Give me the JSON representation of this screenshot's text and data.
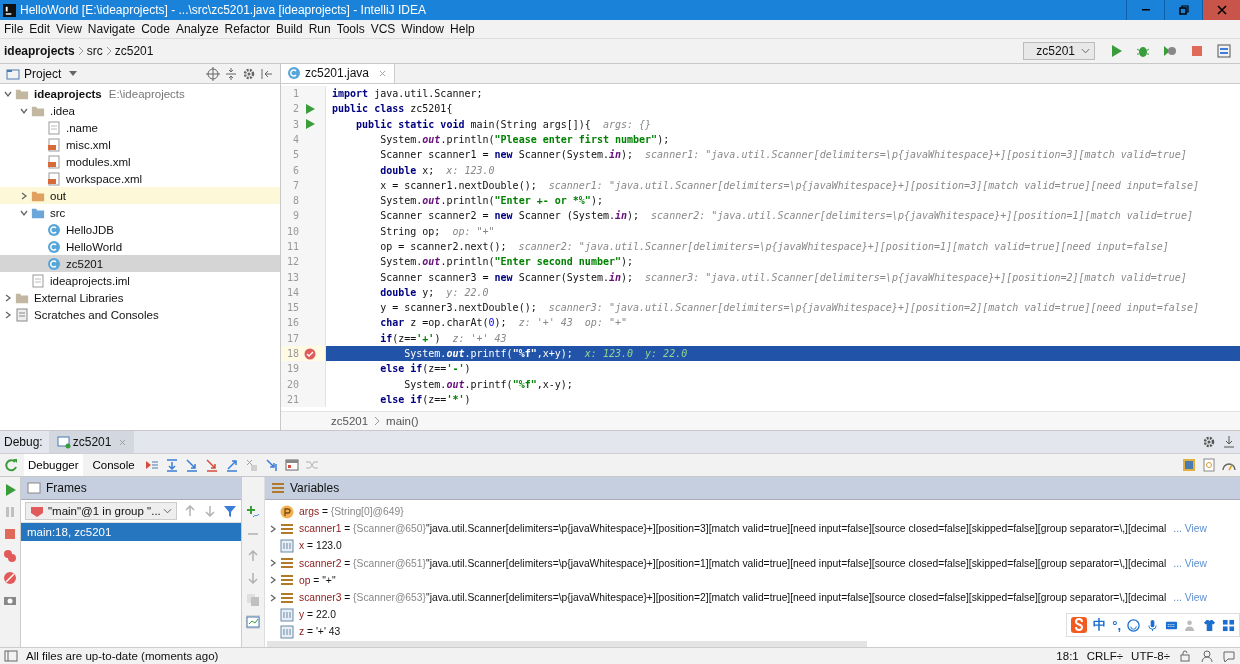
{
  "window": {
    "title": "HelloWorld [E:\\ideaprojects] - ...\\src\\zc5201.java [ideaprojects] - IntelliJ IDEA"
  },
  "menu": [
    "File",
    "Edit",
    "View",
    "Navigate",
    "Code",
    "Analyze",
    "Refactor",
    "Build",
    "Run",
    "Tools",
    "VCS",
    "Window",
    "Help"
  ],
  "breadcrumbs": [
    "ideaprojects",
    "src",
    "zc5201"
  ],
  "run_config": {
    "value": "zc5201"
  },
  "project_panel": {
    "title": "Project",
    "items": [
      {
        "label": "ideaprojects",
        "path": "E:\\ideaprojects",
        "kind": "module",
        "expanded": true,
        "selected": false,
        "excluded": false,
        "children": [
          {
            "label": ".idea",
            "kind": "folder",
            "expanded": true,
            "selected": false,
            "excluded": false,
            "children": [
              {
                "label": ".name",
                "kind": "file",
                "selected": false,
                "excluded": false
              },
              {
                "label": "misc.xml",
                "kind": "xml",
                "selected": false,
                "excluded": false
              },
              {
                "label": "modules.xml",
                "kind": "xml",
                "selected": false,
                "excluded": false
              },
              {
                "label": "workspace.xml",
                "kind": "xml",
                "selected": false,
                "excluded": false
              }
            ]
          },
          {
            "label": "out",
            "kind": "folder",
            "expanded": false,
            "selected": false,
            "excluded": true
          },
          {
            "label": "src",
            "kind": "source",
            "expanded": true,
            "selected": false,
            "excluded": false,
            "children": [
              {
                "label": "HelloJDB",
                "kind": "class",
                "selected": false,
                "excluded": false
              },
              {
                "label": "HelloWorld",
                "kind": "class",
                "selected": false,
                "excluded": false
              },
              {
                "label": "zc5201",
                "kind": "class",
                "selected": true,
                "excluded": false
              }
            ]
          },
          {
            "label": "ideaprojects.iml",
            "kind": "iml",
            "selected": false,
            "excluded": false
          }
        ]
      },
      {
        "label": "External Libraries",
        "kind": "library",
        "expanded": false,
        "selected": false,
        "excluded": false
      },
      {
        "label": "Scratches and Consoles",
        "kind": "scratch",
        "expanded": false,
        "selected": false,
        "excluded": false
      }
    ]
  },
  "editor": {
    "tab": "zc5201.java",
    "breadcrumb": [
      "zc5201",
      "main()"
    ],
    "lines": [
      {
        "number": "1",
        "tokens": [
          {
            "kind": "kw",
            "text": "import"
          },
          {
            "kind": "tx",
            "text": " java.util.Scanner;"
          }
        ]
      },
      {
        "number": "2",
        "run_marker": true,
        "tokens": [
          {
            "kind": "kw",
            "text": "public class"
          },
          {
            "kind": "tx",
            "text": " zc5201{"
          }
        ]
      },
      {
        "number": "3",
        "run_marker": true,
        "tokens": [
          {
            "kind": "kw",
            "text": "    public static void"
          },
          {
            "kind": "tx",
            "text": " main(String args[]){"
          }
        ],
        "hint": "args: {}"
      },
      {
        "number": "4",
        "tokens": [
          {
            "kind": "tx",
            "text": "        System."
          },
          {
            "kind": "fld",
            "text": "out"
          },
          {
            "kind": "tx",
            "text": ".println("
          },
          {
            "kind": "str",
            "text": "\"Please enter first number\""
          },
          {
            "kind": "tx",
            "text": ");"
          }
        ]
      },
      {
        "number": "5",
        "tokens": [
          {
            "kind": "tx",
            "text": "        Scanner scanner1 = "
          },
          {
            "kind": "kw",
            "text": "new"
          },
          {
            "kind": "tx",
            "text": " Scanner(System."
          },
          {
            "kind": "fld",
            "text": "in"
          },
          {
            "kind": "tx",
            "text": ");"
          }
        ],
        "hint": "scanner1: \"java.util.Scanner[delimiters=\\p{javaWhitespace}+][position=3][match valid=true]"
      },
      {
        "number": "6",
        "tokens": [
          {
            "kind": "kw",
            "text": "        double"
          },
          {
            "kind": "tx",
            "text": " x;"
          }
        ],
        "hint": "x: 123.0"
      },
      {
        "number": "7",
        "tokens": [
          {
            "kind": "tx",
            "text": "        x = scanner1.nextDouble();"
          }
        ],
        "hint": "scanner1: \"java.util.Scanner[delimiters=\\p{javaWhitespace}+][position=3][match valid=true][need input=false]"
      },
      {
        "number": "8",
        "tokens": [
          {
            "kind": "tx",
            "text": "        System."
          },
          {
            "kind": "fld",
            "text": "out"
          },
          {
            "kind": "tx",
            "text": ".println("
          },
          {
            "kind": "str",
            "text": "\"Enter +- or *%\""
          },
          {
            "kind": "tx",
            "text": ");"
          }
        ]
      },
      {
        "number": "9",
        "tokens": [
          {
            "kind": "tx",
            "text": "        Scanner scanner2 = "
          },
          {
            "kind": "kw",
            "text": "new"
          },
          {
            "kind": "tx",
            "text": " Scanner (System."
          },
          {
            "kind": "fld",
            "text": "in"
          },
          {
            "kind": "tx",
            "text": ");"
          }
        ],
        "hint": "scanner2: \"java.util.Scanner[delimiters=\\p{javaWhitespace}+][position=1][match valid=true]"
      },
      {
        "number": "10",
        "tokens": [
          {
            "kind": "tx",
            "text": "        String op;"
          }
        ],
        "hint": "op: \"+\""
      },
      {
        "number": "11",
        "tokens": [
          {
            "kind": "tx",
            "text": "        op = scanner2.next();"
          }
        ],
        "hint": "scanner2: \"java.util.Scanner[delimiters=\\p{javaWhitespace}+][position=1][match valid=true][need input=false]"
      },
      {
        "number": "12",
        "tokens": [
          {
            "kind": "tx",
            "text": "        System."
          },
          {
            "kind": "fld",
            "text": "out"
          },
          {
            "kind": "tx",
            "text": ".println("
          },
          {
            "kind": "str",
            "text": "\"Enter second number\""
          },
          {
            "kind": "tx",
            "text": ");"
          }
        ]
      },
      {
        "number": "13",
        "tokens": [
          {
            "kind": "tx",
            "text": "        Scanner scanner3 = "
          },
          {
            "kind": "kw",
            "text": "new"
          },
          {
            "kind": "tx",
            "text": " Scanner(System."
          },
          {
            "kind": "fld",
            "text": "in"
          },
          {
            "kind": "tx",
            "text": ");"
          }
        ],
        "hint": "scanner3: \"java.util.Scanner[delimiters=\\p{javaWhitespace}+][position=2][match valid=true]"
      },
      {
        "number": "14",
        "tokens": [
          {
            "kind": "kw",
            "text": "        double"
          },
          {
            "kind": "tx",
            "text": " y;"
          }
        ],
        "hint": "y: 22.0"
      },
      {
        "number": "15",
        "tokens": [
          {
            "kind": "tx",
            "text": "        y = scanner3.nextDouble();"
          }
        ],
        "hint": "scanner3: \"java.util.Scanner[delimiters=\\p{javaWhitespace}+][position=2][match valid=true][need input=false]"
      },
      {
        "number": "16",
        "tokens": [
          {
            "kind": "kw",
            "text": "        char"
          },
          {
            "kind": "tx",
            "text": " z =op.charAt("
          },
          {
            "kind": "num",
            "text": "0"
          },
          {
            "kind": "tx",
            "text": ");"
          }
        ],
        "hint": "z: '+' 43  op: \"+\""
      },
      {
        "number": "17",
        "tokens": [
          {
            "kind": "kw",
            "text": "        if"
          },
          {
            "kind": "tx",
            "text": "(z=="
          },
          {
            "kind": "str",
            "text": "'+'"
          },
          {
            "kind": "tx",
            "text": ")"
          }
        ],
        "hint": "z: '+' 43"
      },
      {
        "number": "18",
        "breakpoint": true,
        "current": true,
        "tokens": [
          {
            "kind": "tx",
            "text": "            System."
          },
          {
            "kind": "fld",
            "text": "out"
          },
          {
            "kind": "tx",
            "text": ".printf("
          },
          {
            "kind": "str",
            "text": "\"%f\""
          },
          {
            "kind": "tx",
            "text": ",x+y);"
          }
        ],
        "hint": "x: 123.0  y: 22.0"
      },
      {
        "number": "19",
        "tokens": [
          {
            "kind": "kw",
            "text": "        else if"
          },
          {
            "kind": "tx",
            "text": "(z=="
          },
          {
            "kind": "str",
            "text": "'-'"
          },
          {
            "kind": "tx",
            "text": ")"
          }
        ]
      },
      {
        "number": "20",
        "tokens": [
          {
            "kind": "tx",
            "text": "            System."
          },
          {
            "kind": "fld",
            "text": "out"
          },
          {
            "kind": "tx",
            "text": ".printf("
          },
          {
            "kind": "str",
            "text": "\"%f\""
          },
          {
            "kind": "tx",
            "text": ",x-y);"
          }
        ]
      },
      {
        "number": "21",
        "tokens": [
          {
            "kind": "kw",
            "text": "        else if"
          },
          {
            "kind": "tx",
            "text": "(z=="
          },
          {
            "kind": "str",
            "text": "'*'"
          },
          {
            "kind": "tx",
            "text": ")"
          }
        ]
      }
    ]
  },
  "debug": {
    "label": "Debug:",
    "session": "zc5201",
    "tabs": [
      {
        "label": "Debugger",
        "selected": true
      },
      {
        "label": "Console",
        "selected": false
      }
    ],
    "frames": {
      "title": "Frames",
      "thread": "\"main\"@1 in group \"...",
      "items": [
        {
          "label": "main:18, zc5201",
          "selected": true
        }
      ]
    },
    "variables": {
      "title": "Variables",
      "items": [
        {
          "kind": "param",
          "expandable": false,
          "name": "args",
          "sep": "=",
          "ref": "{String[0]@649}"
        },
        {
          "kind": "object",
          "expandable": true,
          "name": "scanner1",
          "sep": "=",
          "ref": "{Scanner@650}",
          "value": "\"java.util.Scanner[delimiters=\\p{javaWhitespace}+][position=3][match valid=true][need input=false][source closed=false][skipped=false][group separator=\\,][decimal",
          "link": "... View"
        },
        {
          "kind": "primitive",
          "expandable": false,
          "name": "x",
          "sep": "=",
          "value": "123.0"
        },
        {
          "kind": "object",
          "expandable": true,
          "name": "scanner2",
          "sep": "=",
          "ref": "{Scanner@651}",
          "value": "\"java.util.Scanner[delimiters=\\p{javaWhitespace}+][position=1][match valid=true][need input=false][source closed=false][skipped=false][group separator=\\,][decimal",
          "link": "... View"
        },
        {
          "kind": "object",
          "expandable": true,
          "name": "op",
          "sep": "=",
          "value": "\"+\""
        },
        {
          "kind": "object",
          "expandable": true,
          "name": "scanner3",
          "sep": "=",
          "ref": "{Scanner@653}",
          "value": "\"java.util.Scanner[delimiters=\\p{javaWhitespace}+][position=2][match valid=true][need input=false][source closed=false][skipped=false][group separator=\\,][decimal",
          "link": "... View"
        },
        {
          "kind": "primitive",
          "expandable": false,
          "name": "y",
          "sep": "=",
          "value": "22.0"
        },
        {
          "kind": "primitive",
          "expandable": false,
          "name": "z",
          "sep": "=",
          "value": "'+' 43"
        }
      ]
    }
  },
  "ime": {
    "mode": "中",
    "punct": "°,"
  },
  "status_bar": {
    "message": "All files are up-to-date (moments ago)",
    "position": "18:1",
    "line_separator": "CRLF÷",
    "encoding": "UTF-8÷"
  }
}
